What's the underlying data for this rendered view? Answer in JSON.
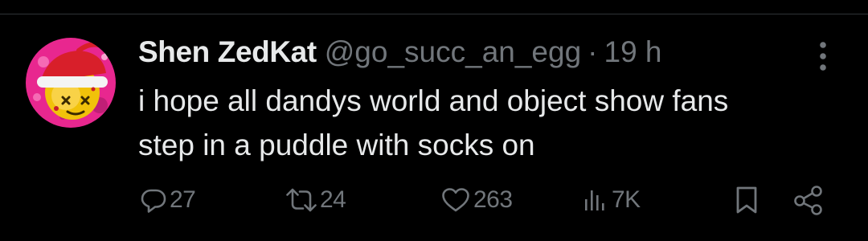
{
  "tweet": {
    "display_name": "Shen ZedKat",
    "handle": "@go_succ_an_egg",
    "separator": "·",
    "time": "19 h",
    "text_lines": [
      "i hope all dandys world and object show fans",
      "step in a puddle with socks on"
    ],
    "avatar_icon": "avatar-icon",
    "more_icon": "more-vertical-icon"
  },
  "actions": {
    "reply": {
      "icon": "reply-icon",
      "count": "27"
    },
    "retweet": {
      "icon": "retweet-icon",
      "count": "24"
    },
    "like": {
      "icon": "heart-icon",
      "count": "263"
    },
    "views": {
      "icon": "views-icon",
      "count": "7K"
    },
    "bookmark": {
      "icon": "bookmark-icon"
    },
    "share": {
      "icon": "share-icon"
    }
  },
  "colors": {
    "background": "#000000",
    "primary_text": "#e7e9ea",
    "secondary_text": "#71767b",
    "divider": "#2f3336",
    "avatar_background": "#e8278f"
  }
}
